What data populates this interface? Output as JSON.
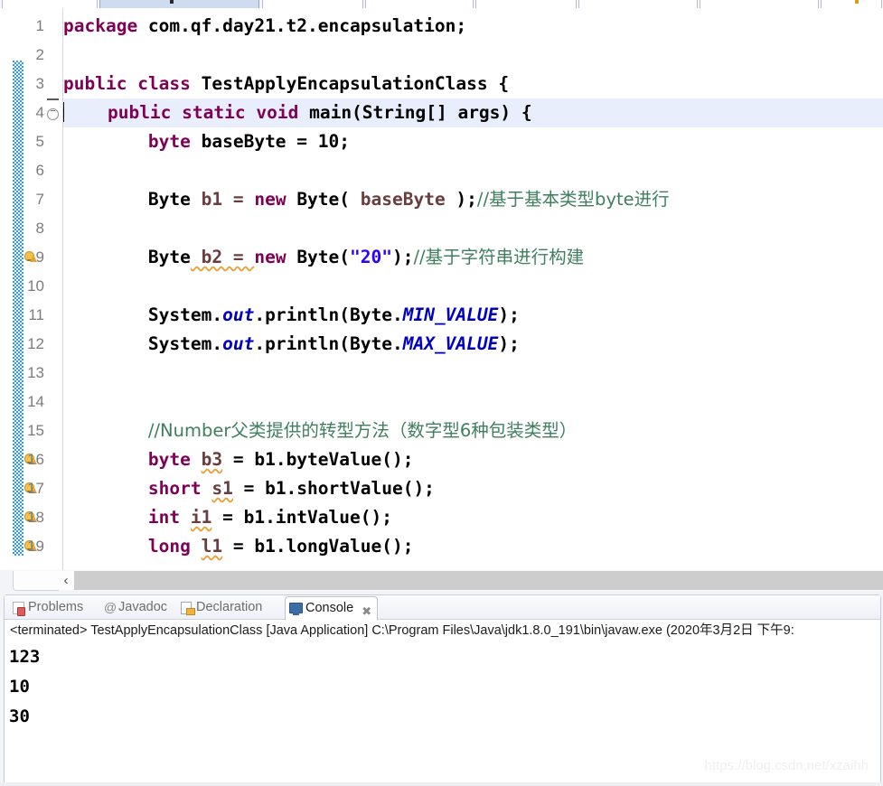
{
  "window": {
    "app": "Eclipse IDE",
    "watermark": "https://blog.csdn.net/xzaihh"
  },
  "editor": {
    "name": "java-source-editor",
    "cursor_line": 4,
    "first_visible_line": 1,
    "lines": [
      {
        "num": "1",
        "warn": false,
        "fold": "none",
        "current": false
      },
      {
        "num": "2",
        "warn": false,
        "fold": "none",
        "current": false
      },
      {
        "num": "3",
        "warn": false,
        "fold": "line",
        "current": false
      },
      {
        "num": "4",
        "warn": false,
        "fold": "collapse",
        "current": true
      },
      {
        "num": "5",
        "warn": false,
        "fold": "none",
        "current": false
      },
      {
        "num": "6",
        "warn": false,
        "fold": "none",
        "current": false
      },
      {
        "num": "7",
        "warn": false,
        "fold": "none",
        "current": false
      },
      {
        "num": "8",
        "warn": false,
        "fold": "none",
        "current": false
      },
      {
        "num": "9",
        "warn": true,
        "fold": "none",
        "current": false
      },
      {
        "num": "10",
        "warn": false,
        "fold": "none",
        "current": false
      },
      {
        "num": "11",
        "warn": false,
        "fold": "none",
        "current": false
      },
      {
        "num": "12",
        "warn": false,
        "fold": "none",
        "current": false
      },
      {
        "num": "13",
        "warn": false,
        "fold": "none",
        "current": false
      },
      {
        "num": "14",
        "warn": false,
        "fold": "none",
        "current": false
      },
      {
        "num": "15",
        "warn": false,
        "fold": "none",
        "current": false
      },
      {
        "num": "16",
        "warn": true,
        "fold": "none",
        "current": false
      },
      {
        "num": "17",
        "warn": true,
        "fold": "none",
        "current": false
      },
      {
        "num": "18",
        "warn": true,
        "fold": "none",
        "current": false
      },
      {
        "num": "19",
        "warn": true,
        "fold": "none",
        "current": false
      }
    ],
    "code_text": {
      "l1": "package com.qf.day21.t2.encapsulation;",
      "l3": "public class TestApplyEncapsulationClass {",
      "l4": "    public static void main(String[] args) {",
      "l5": "        byte baseByte = 10;",
      "l7": "        Byte b1 = new Byte( baseByte );//基于基本类型byte进行",
      "l9": "        Byte b2 = new Byte(\"20\");//基于字符串进行构建",
      "l11": "        System.out.println(Byte.MIN_VALUE);",
      "l12": "        System.out.println(Byte.MAX_VALUE);",
      "l15": "        //Number父类提供的转型方法（数字型6种包装类型）",
      "l16": "        byte b3 = b1.byteValue();",
      "l17": "        short s1 = b1.shortValue();",
      "l18": "        int i1 = b1.intValue();",
      "l19": "        long l1 = b1.longValue();"
    },
    "tokens": {
      "kw_package": "package",
      "pkg_name": " com.qf.day21.t2.encapsulation;",
      "kw_public": "public",
      "kw_class": "class",
      "cls_name": "TestApplyEncapsulationClass",
      "brace_open": "{",
      "kw_static": "static",
      "kw_void": "void",
      "main_sig": "main(String[] args) {",
      "kw_byte": "byte",
      "var_baseByte": " baseByte = 10;",
      "type_Byte": "Byte",
      "var_b1": " b1 = ",
      "kw_new": "new",
      "ctor_b1": " Byte( baseByte );",
      "cmt_l7": "//基于基本类型byte进行",
      "var_b2": " b2 = ",
      "ctor_b2_open": " Byte(",
      "str20": "\"20\"",
      "ctor_b2_close": ");",
      "cmt_l9": "//基于字符串进行构建",
      "sysout_pre": "System.",
      "fld_out": "out",
      "println_open": ".println(Byte.",
      "min_value": "MIN_VALUE",
      "max_value": "MAX_VALUE",
      "println_close": ");",
      "cmt_l15": "//Number父类提供的转型方法（数字型6种包装类型）",
      "var_b3": "b3",
      "call_byteValue": " = b1.byteValue();",
      "kw_short": "short",
      "var_s1": "s1",
      "call_shortValue": " = b1.shortValue();",
      "kw_int": "int",
      "var_i1": "i1",
      "call_intValue": " = b1.intValue();",
      "kw_long": "long",
      "var_l1": "l1",
      "call_longValue": " = b1.longValue();"
    },
    "hscroll": {
      "left_arrow": "‹"
    }
  },
  "bottom_view": {
    "tabs": [
      {
        "label": "Problems",
        "icon": "problems-icon",
        "active": false
      },
      {
        "label": "Javadoc",
        "icon": "javadoc-at-icon",
        "active": false
      },
      {
        "label": "Declaration",
        "icon": "declaration-icon",
        "active": false
      },
      {
        "label": "Console",
        "icon": "console-icon",
        "active": true,
        "close": "✖"
      }
    ],
    "console": {
      "header": "<terminated> TestApplyEncapsulationClass [Java Application] C:\\Program Files\\Java\\jdk1.8.0_191\\bin\\javaw.exe (2020年3月2日 下午9:",
      "output": [
        "123",
        "10",
        "30"
      ]
    }
  },
  "colors": {
    "keyword": "#7f0055",
    "string": "#2a00ff",
    "comment": "#3f7f5f",
    "static_field": "#0000c0",
    "field": "#6a3e3e",
    "current_line": "#e8eefb",
    "change_bar": "#2e9fe0",
    "warning": "#e8a33d"
  }
}
